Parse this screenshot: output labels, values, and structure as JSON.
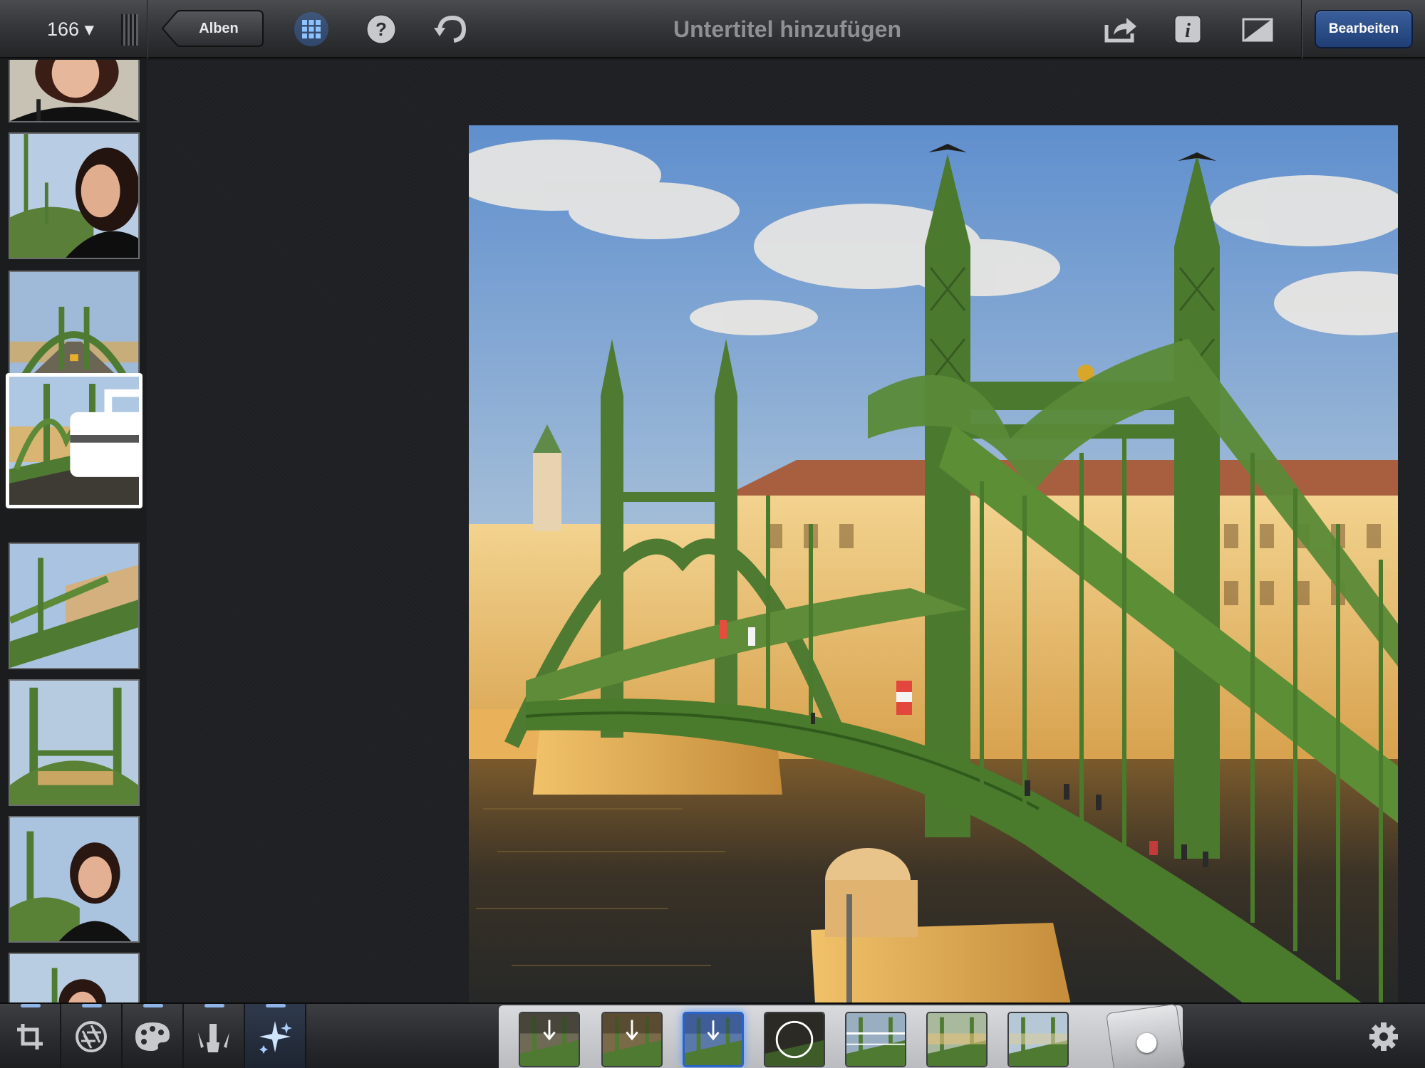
{
  "toolbar": {
    "photo_count": "166 ▾",
    "back_label": "Alben",
    "title": "Untertitel hinzufügen",
    "edit_label": "Bearbeiten",
    "icons": [
      "grid-icon",
      "help-icon",
      "undo-icon",
      "share-icon",
      "info-icon",
      "compare-icon"
    ]
  },
  "thumbnails": [
    {
      "subject": "portrait",
      "selected": false
    },
    {
      "subject": "portrait-bridge",
      "selected": false
    },
    {
      "subject": "bridge-deck",
      "selected": false
    },
    {
      "subject": "bridge",
      "selected": true,
      "badge": "toolkit-icon"
    },
    {
      "subject": "bridge-angle",
      "selected": false
    },
    {
      "subject": "bridge-towers",
      "selected": false
    },
    {
      "subject": "portrait-bridge",
      "selected": false
    },
    {
      "subject": "portrait",
      "selected": false
    }
  ],
  "tools": [
    "crop-icon",
    "exposure-icon",
    "color-palette-icon",
    "brushes-icon",
    "effects-icon"
  ],
  "active_tool": "effects-icon",
  "presets": [
    "gradient-top",
    "gradient-top-dark",
    "gradient-top-selected",
    "vignette",
    "tilt-shift-horizontal",
    "preset-6",
    "preset-7"
  ],
  "colors": {
    "accent": "#2b63c8",
    "edit_button": "#294b86",
    "bridge_green": "#4f7a31",
    "sky": "#6f9ed6"
  }
}
